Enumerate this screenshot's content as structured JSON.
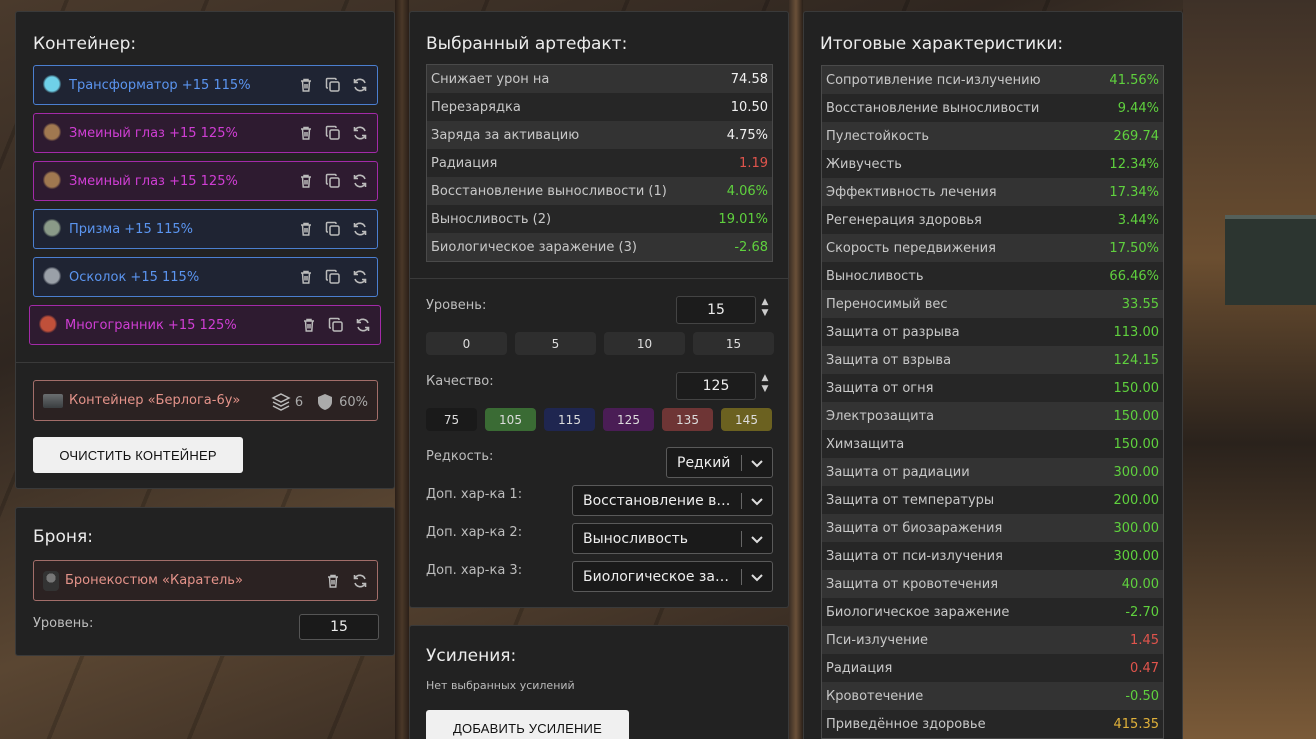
{
  "container": {
    "title": "Контейнер:",
    "artifacts": [
      {
        "label": "Трансформатор +15 115%",
        "style": "blue",
        "icon": "transformer-artifact-icon",
        "color": "#6fd0e8"
      },
      {
        "label": "Змеиный глаз +15 125%",
        "style": "purple",
        "icon": "snake-eye-artifact-icon",
        "color": "#a07850"
      },
      {
        "label": "Змеиный глаз +15 125%",
        "style": "purple",
        "icon": "snake-eye-artifact-icon",
        "color": "#a07850"
      },
      {
        "label": "Призма +15 115%",
        "style": "blue",
        "icon": "prism-artifact-icon",
        "color": "#8a9a88"
      },
      {
        "label": "Осколок +15 115%",
        "style": "blue",
        "icon": "shard-artifact-icon",
        "color": "#9aa0a8"
      },
      {
        "label": "Многогранник +15 125%",
        "style": "purple",
        "icon": "polyhedron-artifact-icon",
        "color": "#c0503a"
      }
    ],
    "container_item": {
      "label": "Контейнер «Берлога-6у»",
      "slots": "6",
      "protection": "60%"
    },
    "clear_button": "ОЧИСТИТЬ КОНТЕЙНЕР"
  },
  "armor": {
    "title": "Броня:",
    "item_label": "Бронекостюм «Каратель»",
    "level_label": "Уровень:",
    "level_value": "15"
  },
  "artifact": {
    "title": "Выбранный артефакт:",
    "stats": [
      {
        "name": "Снижает урон на",
        "value": "74.58",
        "tone": "white"
      },
      {
        "name": "Перезарядка",
        "value": "10.50",
        "tone": "white"
      },
      {
        "name": "Заряда за активацию",
        "value": "4.75%",
        "tone": "white"
      },
      {
        "name": "Радиация",
        "value": "1.19",
        "tone": "red"
      },
      {
        "name": "Восстановление выносливости (1)",
        "value": "4.06%",
        "tone": "green"
      },
      {
        "name": "Выносливость (2)",
        "value": "19.01%",
        "tone": "green"
      },
      {
        "name": "Биологическое заражение (3)",
        "value": "-2.68",
        "tone": "green"
      }
    ],
    "level_label": "Уровень:",
    "level_value": "15",
    "level_presets": [
      "0",
      "5",
      "10",
      "15"
    ],
    "quality_label": "Качество:",
    "quality_value": "125",
    "quality_presets": [
      {
        "label": "75",
        "color": "#1a1a1a"
      },
      {
        "label": "105",
        "color": "#3a6b34"
      },
      {
        "label": "115",
        "color": "#1f2650"
      },
      {
        "label": "125",
        "color": "#4a1d55"
      },
      {
        "label": "135",
        "color": "#6e3535"
      },
      {
        "label": "145",
        "color": "#6b6120"
      }
    ],
    "rarity_label": "Редкость:",
    "rarity_value": "Редкий",
    "extra1_label": "Доп. хар-ка 1:",
    "extra1_value": "Восстановление выносливости",
    "extra2_label": "Доп. хар-ка 2:",
    "extra2_value": "Выносливость",
    "extra3_label": "Доп. хар-ка 3:",
    "extra3_value": "Биологическое заражение"
  },
  "upgrades": {
    "title": "Усиления:",
    "empty_text": "Нет выбранных усилений",
    "add_button": "ДОБАВИТЬ УСИЛЕНИЕ"
  },
  "totals": {
    "title": "Итоговые характеристики:",
    "stats": [
      {
        "name": "Сопротивление пси-излучению",
        "value": "41.56%",
        "tone": "green"
      },
      {
        "name": "Восстановление выносливости",
        "value": "9.44%",
        "tone": "green"
      },
      {
        "name": "Пулестойкость",
        "value": "269.74",
        "tone": "green"
      },
      {
        "name": "Живучесть",
        "value": "12.34%",
        "tone": "green"
      },
      {
        "name": "Эффективность лечения",
        "value": "17.34%",
        "tone": "green"
      },
      {
        "name": "Регенерация здоровья",
        "value": "3.44%",
        "tone": "green"
      },
      {
        "name": "Скорость передвижения",
        "value": "17.50%",
        "tone": "green"
      },
      {
        "name": "Выносливость",
        "value": "66.46%",
        "tone": "green"
      },
      {
        "name": "Переносимый вес",
        "value": "33.55",
        "tone": "green"
      },
      {
        "name": "Защита от разрыва",
        "value": "113.00",
        "tone": "green"
      },
      {
        "name": "Защита от взрыва",
        "value": "124.15",
        "tone": "green"
      },
      {
        "name": "Защита от огня",
        "value": "150.00",
        "tone": "green"
      },
      {
        "name": "Электрозащита",
        "value": "150.00",
        "tone": "green"
      },
      {
        "name": "Химзащита",
        "value": "150.00",
        "tone": "green"
      },
      {
        "name": "Защита от радиации",
        "value": "300.00",
        "tone": "green"
      },
      {
        "name": "Защита от температуры",
        "value": "200.00",
        "tone": "green"
      },
      {
        "name": "Защита от биозаражения",
        "value": "300.00",
        "tone": "green"
      },
      {
        "name": "Защита от пси-излучения",
        "value": "300.00",
        "tone": "green"
      },
      {
        "name": "Защита от кровотечения",
        "value": "40.00",
        "tone": "green"
      },
      {
        "name": "Биологическое заражение",
        "value": "-2.70",
        "tone": "green"
      },
      {
        "name": "Пси-излучение",
        "value": "1.45",
        "tone": "red"
      },
      {
        "name": "Радиация",
        "value": "0.47",
        "tone": "red"
      },
      {
        "name": "Кровотечение",
        "value": "-0.50",
        "tone": "green"
      },
      {
        "name": "Приведённое здоровье",
        "value": "415.35",
        "tone": "yellow"
      }
    ]
  }
}
